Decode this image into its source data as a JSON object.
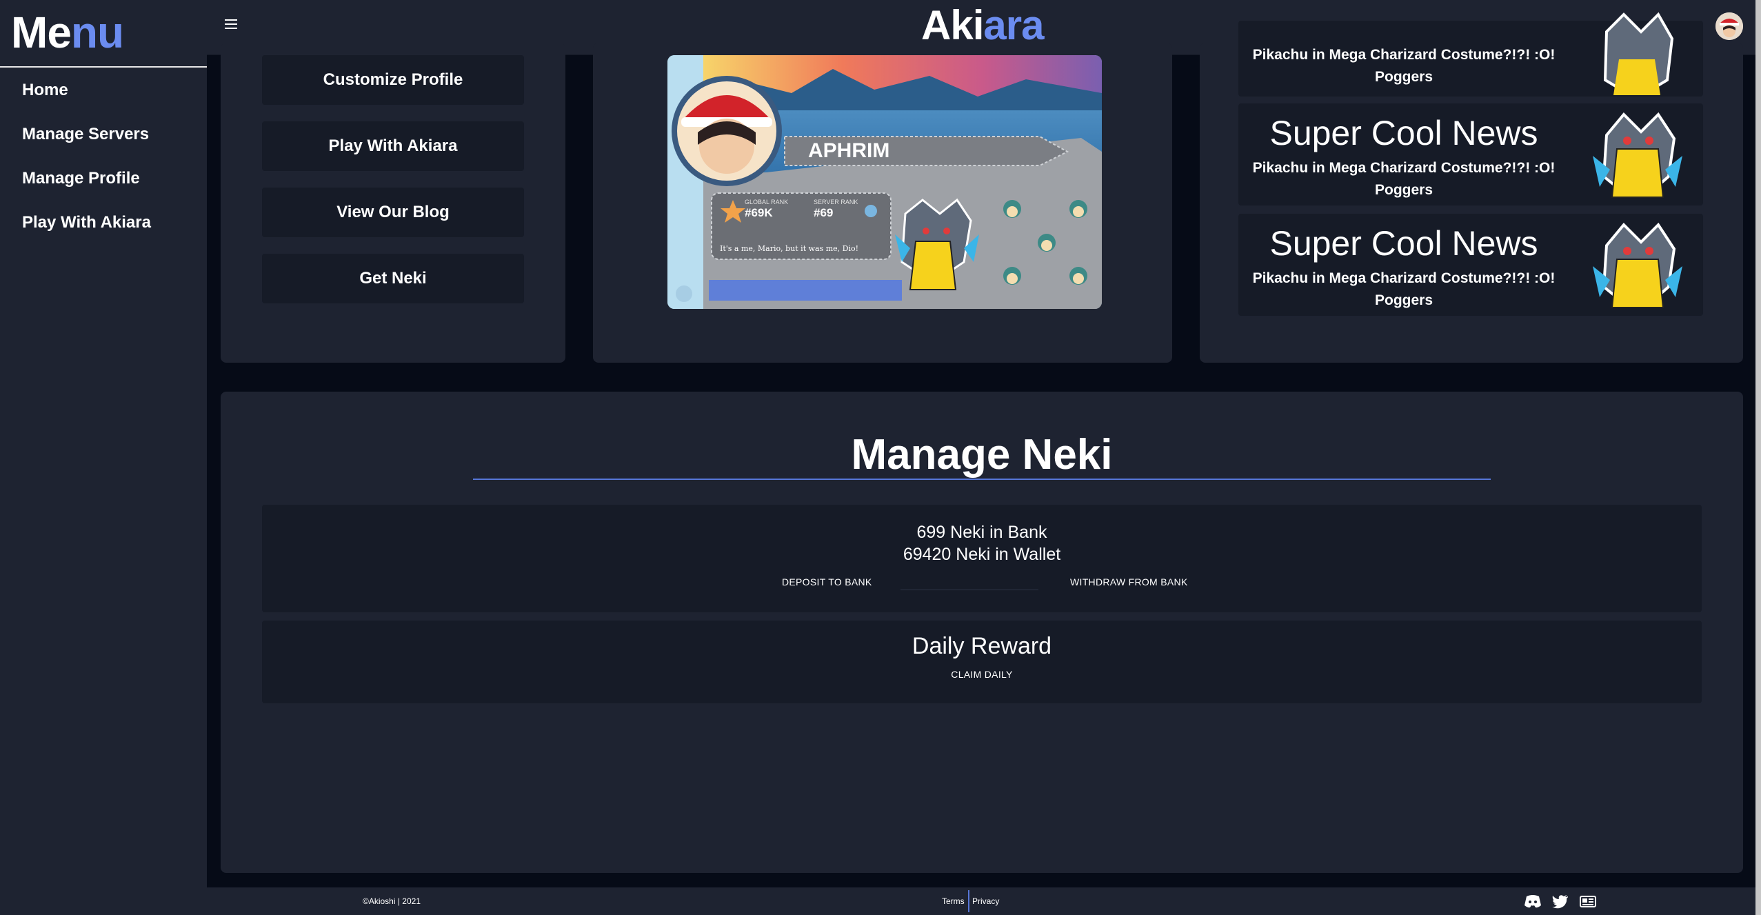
{
  "sidebar": {
    "title_main": "Me",
    "title_accent": "nu",
    "items": [
      {
        "label": "Home"
      },
      {
        "label": "Manage Servers"
      },
      {
        "label": "Manage Profile"
      },
      {
        "label": "Play With Akiara"
      }
    ]
  },
  "header": {
    "brand_main": "Aki",
    "brand_accent": "ara",
    "menu_icon": "hamburger-icon"
  },
  "quick_actions": [
    {
      "label": "Customize Profile"
    },
    {
      "label": "Play With Akiara"
    },
    {
      "label": "View Our Blog"
    },
    {
      "label": "Get Neki"
    }
  ],
  "profile_card": {
    "username": "APHRIM",
    "global_rank_label": "GLOBAL RANK",
    "global_rank": "#69K",
    "server_rank_label": "SERVER RANK",
    "server_rank": "#69",
    "bio": "It's a me, Mario, but it was me, Dio!"
  },
  "news": [
    {
      "title": "",
      "body_line1": "Pikachu in Mega Charizard Costume?!?! :O!",
      "body_line2": "Poggers"
    },
    {
      "title": "Super Cool News",
      "body_line1": "Pikachu in Mega Charizard Costume?!?! :O!",
      "body_line2": "Poggers"
    },
    {
      "title": "Super Cool News",
      "body_line1": "Pikachu in Mega Charizard Costume?!?! :O!",
      "body_line2": "Poggers"
    }
  ],
  "manage_neki": {
    "title": "Manage Neki",
    "bank_text": "699 Neki in Bank",
    "wallet_text": "69420 Neki in Wallet",
    "deposit_label": "DEPOSIT TO BANK",
    "withdraw_label": "WITHDRAW FROM BANK",
    "amount_value": ""
  },
  "daily": {
    "title": "Daily Reward",
    "claim_label": "CLAIM DAILY"
  },
  "footer": {
    "copyright": "©Akioshi | 2021",
    "terms": "Terms",
    "privacy": "Privacy",
    "icons": [
      "discord-icon",
      "twitter-icon",
      "newspaper-icon"
    ]
  },
  "colors": {
    "accent": "#6b8cf0",
    "panel": "#1e2331",
    "background": "#060b17"
  }
}
